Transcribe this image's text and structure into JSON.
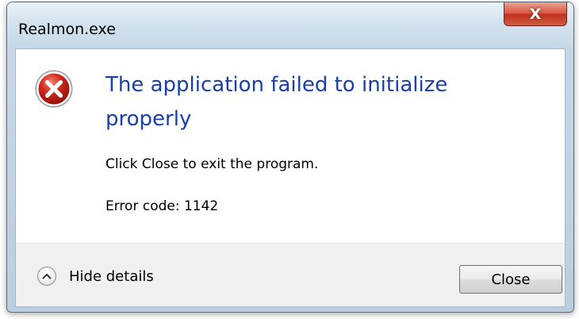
{
  "window": {
    "title": "Realmon.exe",
    "close_glyph": "X"
  },
  "dialog": {
    "icon": "error-icon",
    "main_instruction": "The application failed to initialize properly",
    "content_lines": [
      "Click Close to exit the program.",
      "Error code: 1142"
    ]
  },
  "footer": {
    "details_toggle_label": "Hide details",
    "details_toggle_icon": "chevron-up-icon",
    "close_button_label": "Close"
  },
  "colors": {
    "instruction_text": "#1a3fa8",
    "error_icon": "#c0221b",
    "title_close_button": "#c9422f"
  }
}
